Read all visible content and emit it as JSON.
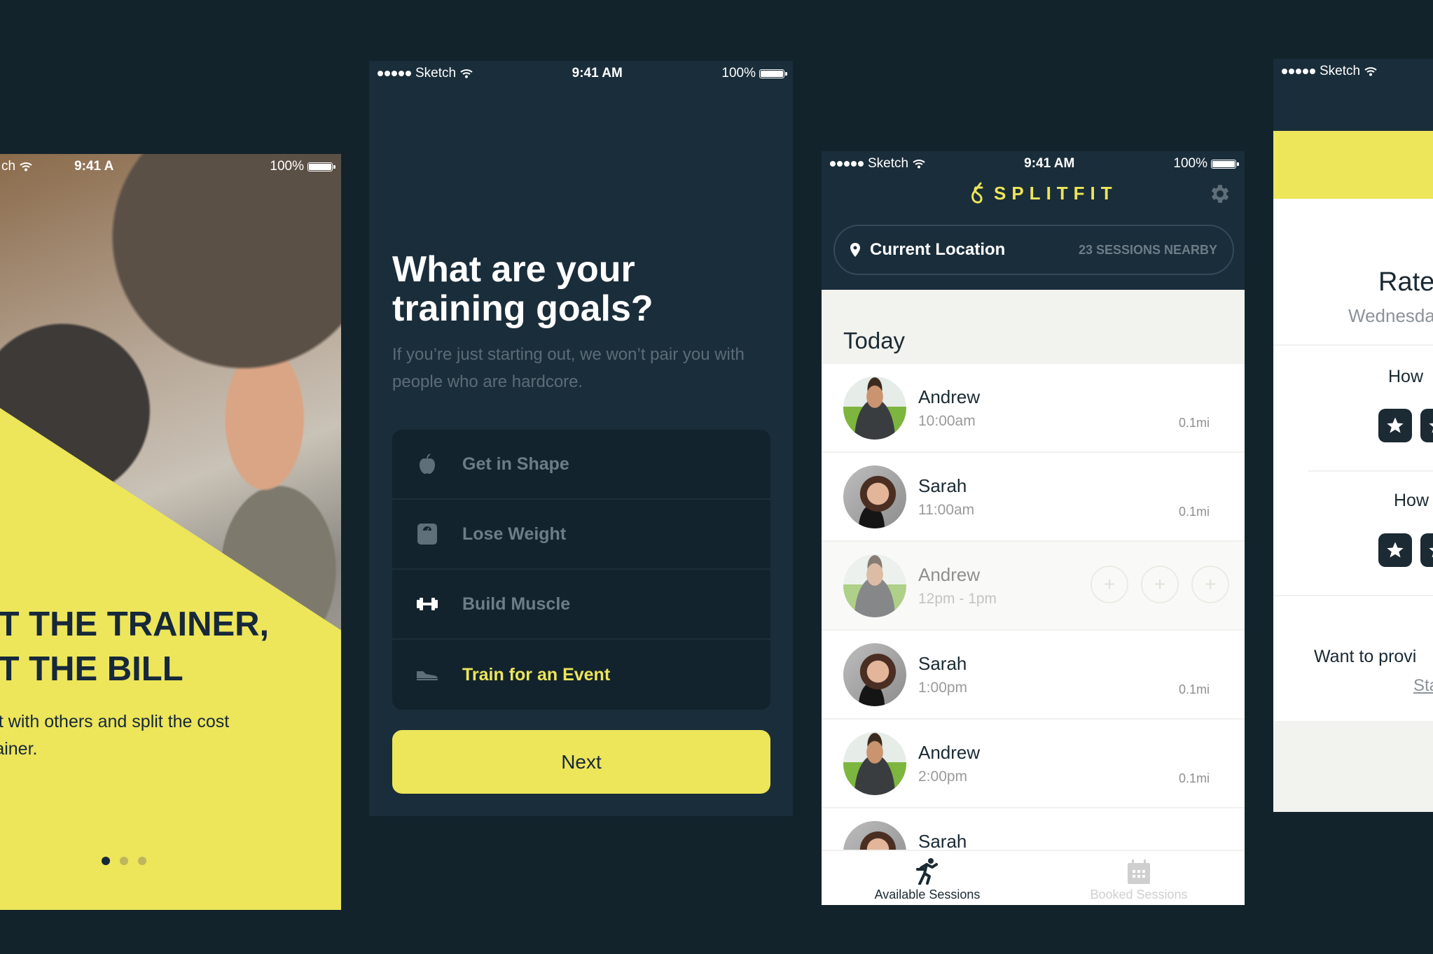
{
  "status_bar": {
    "carrier": "Sketch",
    "time": "9:41 AM",
    "battery": "100%"
  },
  "onboarding": {
    "status_time_partial": "9:41 A",
    "status_carrier_partial": "ch",
    "headline_line1": "IT THE TRAINER,",
    "headline_line2": "IT THE BILL",
    "subtext_line1": "ut with others and split the cost",
    "subtext_line2": "rainer.",
    "pager": {
      "total": 3,
      "active_index": 0
    }
  },
  "goals_screen": {
    "title_line1": "What are your",
    "title_line2": "training goals?",
    "description": "If you’re just starting out, we won’t pair you with people who are hardcore.",
    "options": [
      {
        "label": "Get in Shape",
        "icon": "apple-icon",
        "selected": false
      },
      {
        "label": "Lose Weight",
        "icon": "scale-icon",
        "selected": false
      },
      {
        "label": "Build Muscle",
        "icon": "dumbbell-icon",
        "selected": false
      },
      {
        "label": "Train for an Event",
        "icon": "sneaker-icon",
        "selected": true
      }
    ],
    "next_label": "Next"
  },
  "sessions_screen": {
    "brand": "SPLITFIT",
    "location_label": "Current Location",
    "sessions_nearby": "23 SESSIONS NEARBY",
    "section_title": "Today",
    "sessions": [
      {
        "name": "Andrew",
        "time": "10:00am",
        "distance": "0.1mi",
        "avatar": "male",
        "state": "available"
      },
      {
        "name": "Sarah",
        "time": "11:00am",
        "distance": "0.1mi",
        "avatar": "female",
        "state": "available"
      },
      {
        "name": "Andrew",
        "time": "12pm - 1pm",
        "distance": "",
        "avatar": "male",
        "state": "expanded",
        "open_slots": 3
      },
      {
        "name": "Sarah",
        "time": "1:00pm",
        "distance": "0.1mi",
        "avatar": "female",
        "state": "available"
      },
      {
        "name": "Andrew",
        "time": "2:00pm",
        "distance": "0.1mi",
        "avatar": "male",
        "state": "available"
      },
      {
        "name": "Sarah",
        "time": "",
        "distance": "",
        "avatar": "female",
        "state": "partial"
      }
    ],
    "tabs": [
      {
        "label": "Available Sessions",
        "icon": "runner-icon",
        "active": true
      },
      {
        "label": "Booked Sessions",
        "icon": "calendar-icon",
        "active": false
      }
    ]
  },
  "rating_screen": {
    "title_partial": "Rate",
    "date_partial": "Wednesda",
    "question1_partial": "How",
    "question2_partial": "How",
    "feedback_prompt_partial": "Want to provi",
    "link_partial": "Sta"
  },
  "colors": {
    "background": "#13232c",
    "panel": "#1a2d3a",
    "accent_yellow": "#ede55a",
    "text_dark": "#1b2a33",
    "muted": "#6d7d88"
  }
}
